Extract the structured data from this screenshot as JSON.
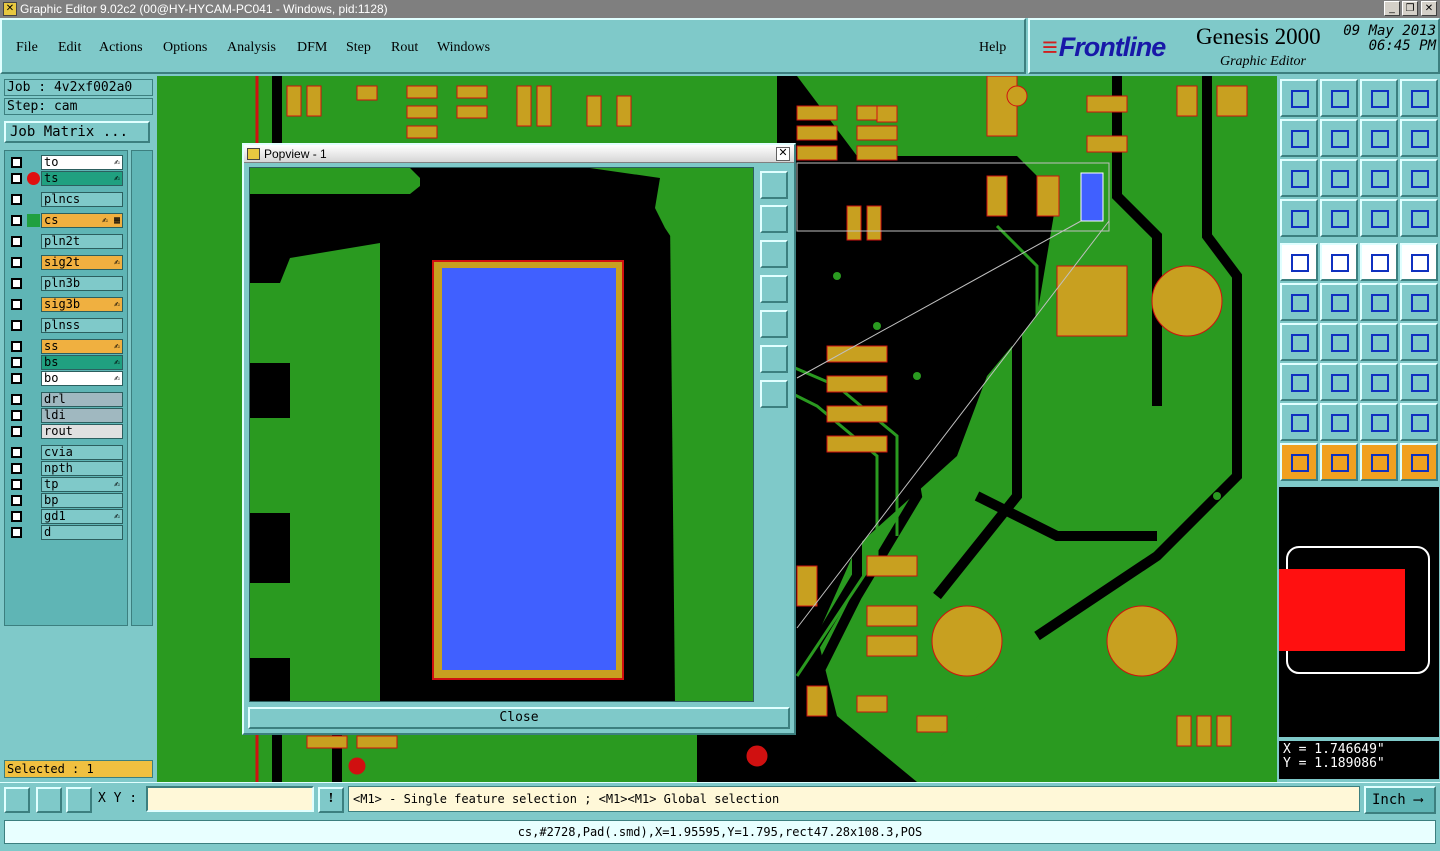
{
  "window": {
    "title": "Graphic Editor 9.02c2 (00@HY-HYCAM-PC041 - Windows, pid:1128)"
  },
  "menu": [
    "File",
    "Edit",
    "Actions",
    "Options",
    "Analysis",
    "DFM",
    "Step",
    "Rout",
    "Windows"
  ],
  "help_label": "Help",
  "brand": {
    "logo": "Frontline",
    "product": "Genesis 2000",
    "subtitle": "Graphic Editor",
    "date": "09 May 2013",
    "time": "06:45 PM"
  },
  "job": {
    "job_label": "Job : 4v2xf002a0",
    "step_label": "Step: cam",
    "matrix_button": "Job Matrix ..."
  },
  "layers": [
    {
      "name": "to",
      "color": "#ffffff",
      "marker": "",
      "icon": "✍"
    },
    {
      "name": "ts",
      "color": "#20a080",
      "marker": "red-dot",
      "icon": "✍"
    },
    {
      "name": "plncs",
      "color": "#7fc9c9",
      "marker": "",
      "icon": ""
    },
    {
      "name": "cs",
      "color": "#f0b040",
      "marker": "edit",
      "icon": "✍ ▦",
      "active": true
    },
    {
      "name": "pln2t",
      "color": "#7fc9c9",
      "marker": "",
      "icon": ""
    },
    {
      "name": "sig2t",
      "color": "#f0b040",
      "marker": "",
      "icon": "✍"
    },
    {
      "name": "pln3b",
      "color": "#7fc9c9",
      "marker": "",
      "icon": ""
    },
    {
      "name": "sig3b",
      "color": "#f0b040",
      "marker": "",
      "icon": "✍"
    },
    {
      "name": "plnss",
      "color": "#7fc9c9",
      "marker": "",
      "icon": ""
    },
    {
      "name": "ss",
      "color": "#f0b040",
      "marker": "",
      "icon": "✍"
    },
    {
      "name": "bs",
      "color": "#20a080",
      "marker": "",
      "icon": "✍"
    },
    {
      "name": "bo",
      "color": "#ffffff",
      "marker": "",
      "icon": "✍"
    },
    {
      "name": "drl",
      "color": "#a0b8c0",
      "marker": "",
      "icon": ""
    },
    {
      "name": "ldi",
      "color": "#a0b8c0",
      "marker": "",
      "icon": ""
    },
    {
      "name": "rout",
      "color": "#e0e0e0",
      "marker": "",
      "icon": ""
    },
    {
      "name": "cvia",
      "color": "#7fc9c9",
      "marker": "",
      "icon": ""
    },
    {
      "name": "npth",
      "color": "#7fc9c9",
      "marker": "",
      "icon": ""
    },
    {
      "name": "tp",
      "color": "#7fc9c9",
      "marker": "",
      "icon": "✍"
    },
    {
      "name": "bp",
      "color": "#7fc9c9",
      "marker": "",
      "icon": ""
    },
    {
      "name": "gd1",
      "color": "#7fc9c9",
      "marker": "",
      "icon": "✍"
    },
    {
      "name": "d",
      "color": "#7fc9c9",
      "marker": "",
      "icon": ""
    }
  ],
  "selected": "Selected : 1",
  "popview": {
    "title": "Popview - 1",
    "close_label": "Close"
  },
  "coords": {
    "x": "X = 1.746649\"",
    "y": "Y = 1.189086\""
  },
  "bottom": {
    "xy_label": "X Y :",
    "xy_value": "",
    "hint": "<M1> - Single feature selection ; <M1><M1> Global selection",
    "unit": "Inch"
  },
  "status": "cs,#2728,Pad(.smd),X=1.95595,Y=1.795,rect47.28x108.3,POS",
  "colors": {
    "copper": "#c8a020",
    "pcb_green": "#2a9a20",
    "background": "#000000",
    "selected": "#4060ff",
    "panel": "#7fc9c9"
  }
}
